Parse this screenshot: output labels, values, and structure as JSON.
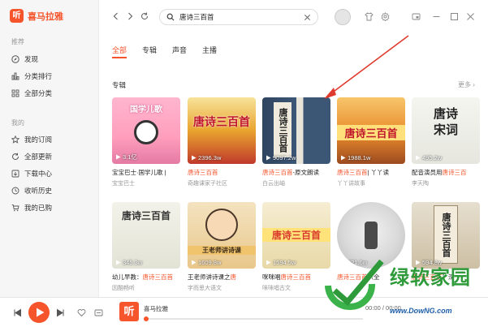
{
  "app": {
    "name": "喜马拉雅",
    "logo_char": "听"
  },
  "sidebar": {
    "section1": "推荐",
    "items1": [
      {
        "label": "发现",
        "icon": "compass-icon"
      },
      {
        "label": "分类排行",
        "icon": "ranking-icon"
      },
      {
        "label": "全部分类",
        "icon": "grid-icon"
      }
    ],
    "section2": "我的",
    "items2": [
      {
        "label": "我的订阅",
        "icon": "star-icon"
      },
      {
        "label": "全部更新",
        "icon": "refresh-icon"
      },
      {
        "label": "下载中心",
        "icon": "download-icon"
      },
      {
        "label": "收听历史",
        "icon": "clock-icon"
      },
      {
        "label": "我的已购",
        "icon": "cart-icon"
      }
    ]
  },
  "search": {
    "query": "唐诗三百首"
  },
  "tabs": [
    {
      "label": "全部",
      "active": true
    },
    {
      "label": "专辑",
      "active": false
    },
    {
      "label": "声音",
      "active": false
    },
    {
      "label": "主播",
      "active": false
    }
  ],
  "section": {
    "title": "专辑",
    "more": "更多"
  },
  "albums": [
    {
      "plays": "3.1亿",
      "title_pre": "宝宝巴士·国学儿歌 |",
      "title_hl": "",
      "title_post": "",
      "author": "宝宝巴士",
      "cover_text": "国学儿歌"
    },
    {
      "plays": "2396.3w",
      "title_pre": "",
      "title_hl": "唐诗三百首",
      "title_post": "",
      "author": "奇趣课家子社区",
      "cover_text": "唐诗三百首"
    },
    {
      "plays": "9097.2w",
      "title_pre": "",
      "title_hl": "唐诗三百首",
      "title_post": "-原文朗读",
      "author": "白云出岫",
      "cover_text": "唐诗三百首"
    },
    {
      "plays": "1988.1w",
      "title_pre": "",
      "title_hl": "唐诗三百首",
      "title_post": "| 丫丫读",
      "author": "丫丫讲故事",
      "cover_text": "唐诗三百首"
    },
    {
      "plays": "495.2w",
      "title_pre": "配音演员用",
      "title_hl": "唐诗三百",
      "title_post": "",
      "author": "李天陶",
      "cover_text": "唐诗宋词"
    },
    {
      "plays": "345.3w",
      "title_pre": "幼儿早教：",
      "title_hl": "唐诗三百首",
      "title_post": "",
      "author": "因酷畅听",
      "cover_text": "唐诗三百首"
    },
    {
      "plays": "1609.8w",
      "title_pre": "王老师讲诗课之",
      "title_hl": "唐",
      "title_post": "",
      "author": "字而思大语文",
      "cover_text": "王老师讲诗课"
    },
    {
      "plays": "1594.5w",
      "title_pre": "咪咪唱",
      "title_hl": "唐诗三百首",
      "title_post": "",
      "author": "咪咪唱古文",
      "cover_text": "唐诗三百首"
    },
    {
      "plays": "421.6w",
      "title_pre": "",
      "title_hl": "唐诗三百首",
      "title_post": "（全",
      "author": "",
      "cover_text": ""
    },
    {
      "plays": "594.8w",
      "title_pre": "",
      "title_hl": "唐诗三百首",
      "title_post": "》深",
      "author": "",
      "cover_text": "唐诗三百首"
    }
  ],
  "player": {
    "now_title": "喜马拉雅",
    "time": "00:00 / 00:00"
  },
  "watermark": {
    "text": "绿软家园",
    "url": "www.DowNG.com"
  },
  "colors": {
    "accent": "#f6542b",
    "sidebar_bg": "#f6f6f6"
  }
}
